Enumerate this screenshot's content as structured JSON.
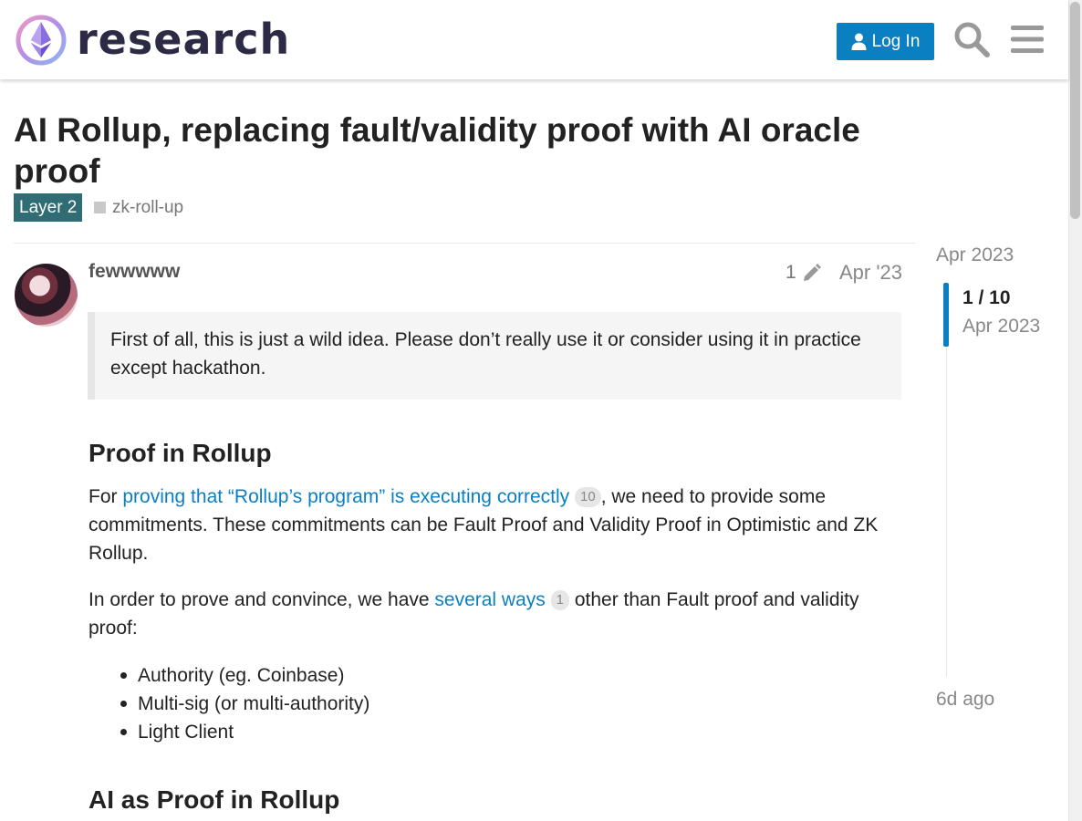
{
  "header": {
    "logo_text": "research",
    "login_label": "Log In",
    "icons": [
      "ethereum-logo-icon",
      "user-icon",
      "search-icon",
      "hamburger-menu-icon"
    ]
  },
  "topic": {
    "title": "AI Rollup, replacing fault/validity proof with AI oracle proof",
    "category": "Layer 2",
    "tag": "zk-roll-up"
  },
  "post": {
    "username": "fewwwww",
    "edit_count": "1",
    "date": "Apr '23",
    "quote": "First of all, this is just a wild idea. Please don’t really use it or consider using it in practice except hackathon.",
    "heading1": "Proof in Rollup",
    "para1_pre": "For ",
    "para1_link": "proving that “Rollup’s program” is executing correctly",
    "para1_link_clicks": "10",
    "para1_post": ", we need to provide some commitments. These commitments can be Fault Proof and Validity Proof in Optimistic and ZK Rollup.",
    "para2_pre": "In order to prove and convince, we have ",
    "para2_link": "several ways",
    "para2_link_clicks": "1",
    "para2_post": " other than Fault proof and validity proof:",
    "bullets": [
      "Authority (eg. Coinbase)",
      "Multi-sig (or multi-authority)",
      "Light Client"
    ],
    "heading2": "AI as Proof in Rollup"
  },
  "timeline": {
    "start_date": "Apr 2023",
    "progress": "1 / 10",
    "handle_date": "Apr 2023",
    "end_label": "6d ago"
  },
  "colors": {
    "accent": "#0a7fc2",
    "category_bg": "#2f6c73",
    "logo_text": "#2c2a45"
  }
}
